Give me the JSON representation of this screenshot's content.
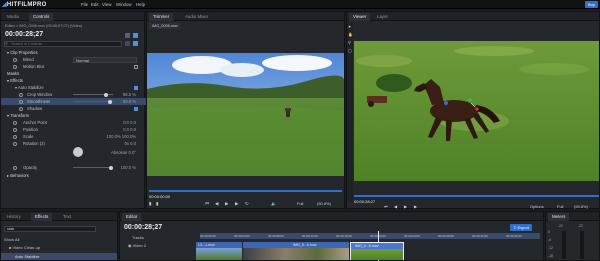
{
  "app": {
    "logo": "HITFILMPRO",
    "menu": [
      "File",
      "Edit",
      "View",
      "Window",
      "Help"
    ],
    "top_button": "Buy"
  },
  "controls": {
    "tabs": [
      "Media",
      "Controls"
    ],
    "path": "Editor > IMG_0006.mov (00:00:07;07) (Video)",
    "timecode": "00:00:28;27",
    "search_placeholder": "Search in Controls",
    "blend_label": "Blend",
    "blend_value": "Normal",
    "motion_blur_label": "Motion Blur",
    "sections": {
      "clip_properties": "Clip Properties",
      "masks": "Masks",
      "effects": "Effects",
      "auto_stabilize": "Auto Stabilize",
      "crop_window": "Crop Window",
      "crop_window_value": "86.5 %",
      "smoothness": "Smoothness",
      "smoothness_value": "93.5 %",
      "shadow": "Shadow",
      "transform": "Transform",
      "anchor_point": "Anchor Point",
      "anchor_point_value": "0.0  0.0",
      "position": "Position",
      "position_value": "0.0  0.0",
      "scale": "Scale",
      "scale_value": "100.0%  100.0%",
      "rotation": "Rotation (2)",
      "rotation_value": "0x  0.0",
      "absolute": "Absolute 0.0°",
      "opacity": "Opacity",
      "opacity_value": "100.0 %",
      "behaviors": "Behaviors"
    }
  },
  "trimmer": {
    "tabs": [
      "Trimmer",
      "Audio Mixer"
    ],
    "filename": "IMG_0006.mov",
    "timecode": "00:00:00;00",
    "end_time": "00:00:17;08",
    "zoom": "Full",
    "fit": "(50.8%)"
  },
  "viewer": {
    "tabs": [
      "Viewer",
      "Layer"
    ],
    "timecode": "00:00:28;27",
    "end_time": "00:00:29;27",
    "options": "Options",
    "zoom": "Full",
    "fit": "(59.8%)"
  },
  "history": {
    "tabs": [
      "History",
      "Effects",
      "Text"
    ],
    "search_value": "stab",
    "show_all": "Show All",
    "items": [
      "Video Clean-up",
      "Auto Stabilize"
    ]
  },
  "editor": {
    "tab": "Editor",
    "timecode": "00:00:28;27",
    "export": "Export",
    "tracks_label": "Tracks",
    "video_track": "Video 2",
    "ruler": [
      "00;00;00;00",
      "00;00;04;00",
      "00;00;08;00",
      "00;00;12;00",
      "00;00;16;00",
      "00;00;20;00",
      "00;00;24;00",
      "00;00;28;00",
      "00;00;32;00",
      "00;00;36;00"
    ],
    "clips": [
      {
        "label": "L3...1.mov"
      },
      {
        "label": "IMG_5...5.mov"
      },
      {
        "label": "IMG_0...6.mov"
      }
    ]
  },
  "meters": {
    "tab": "Meters",
    "scale": [
      "0",
      "-6",
      "-12",
      "-18"
    ],
    "labels": [
      "-22",
      "-22"
    ]
  },
  "colors": {
    "accent": "#2f6fd0",
    "selection": "#3a4a6a",
    "clip_blue": "#3d67b3"
  }
}
